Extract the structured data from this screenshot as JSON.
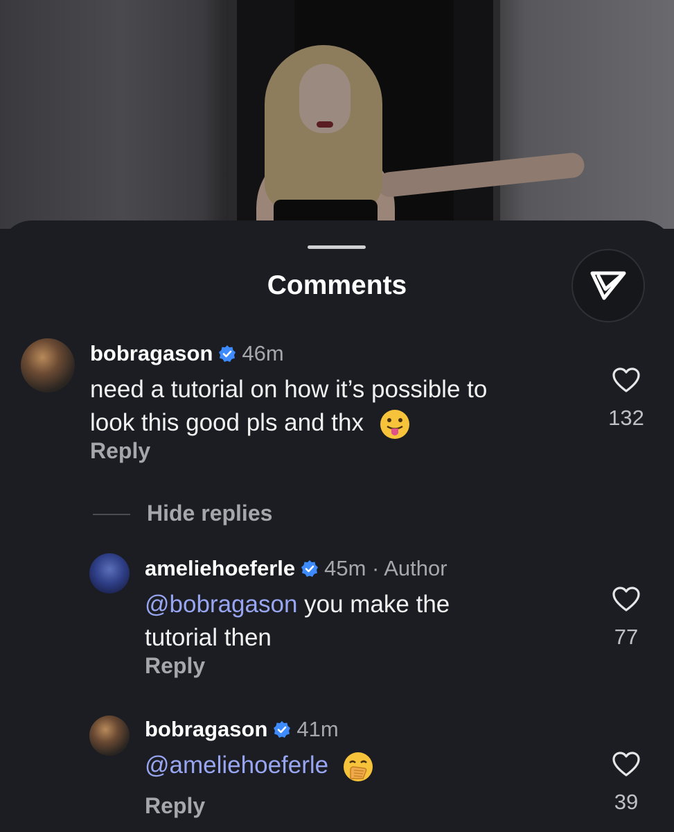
{
  "sheet": {
    "title": "Comments",
    "send_icon": "send-paper-plane-icon"
  },
  "thread": {
    "hide_replies_label": "Hide replies"
  },
  "comments": [
    {
      "username": "bobragason",
      "verified": true,
      "time": "46m",
      "text_line1": "need a tutorial on how it’s possible to",
      "text_line2": "look this good pls and thx",
      "emoji": "face-with-tongue",
      "reply_label": "Reply",
      "likes": "132"
    }
  ],
  "replies": [
    {
      "username": "ameliehoeferle",
      "verified": true,
      "time": "45m · Author",
      "mention": "@bobragason",
      "text_after_mention": " you make the",
      "text_line2": "tutorial then",
      "reply_label": "Reply",
      "likes": "77"
    },
    {
      "username": "bobragason",
      "verified": true,
      "time": "41m",
      "mention": "@ameliehoeferle",
      "emoji": "face-with-hand-over-mouth",
      "reply_label": "Reply",
      "likes": "39"
    }
  ],
  "colors": {
    "background": "#1b1d22",
    "verified_blue": "#3d8bfd",
    "mention": "#98a6f2",
    "muted": "#a6a7ab"
  }
}
